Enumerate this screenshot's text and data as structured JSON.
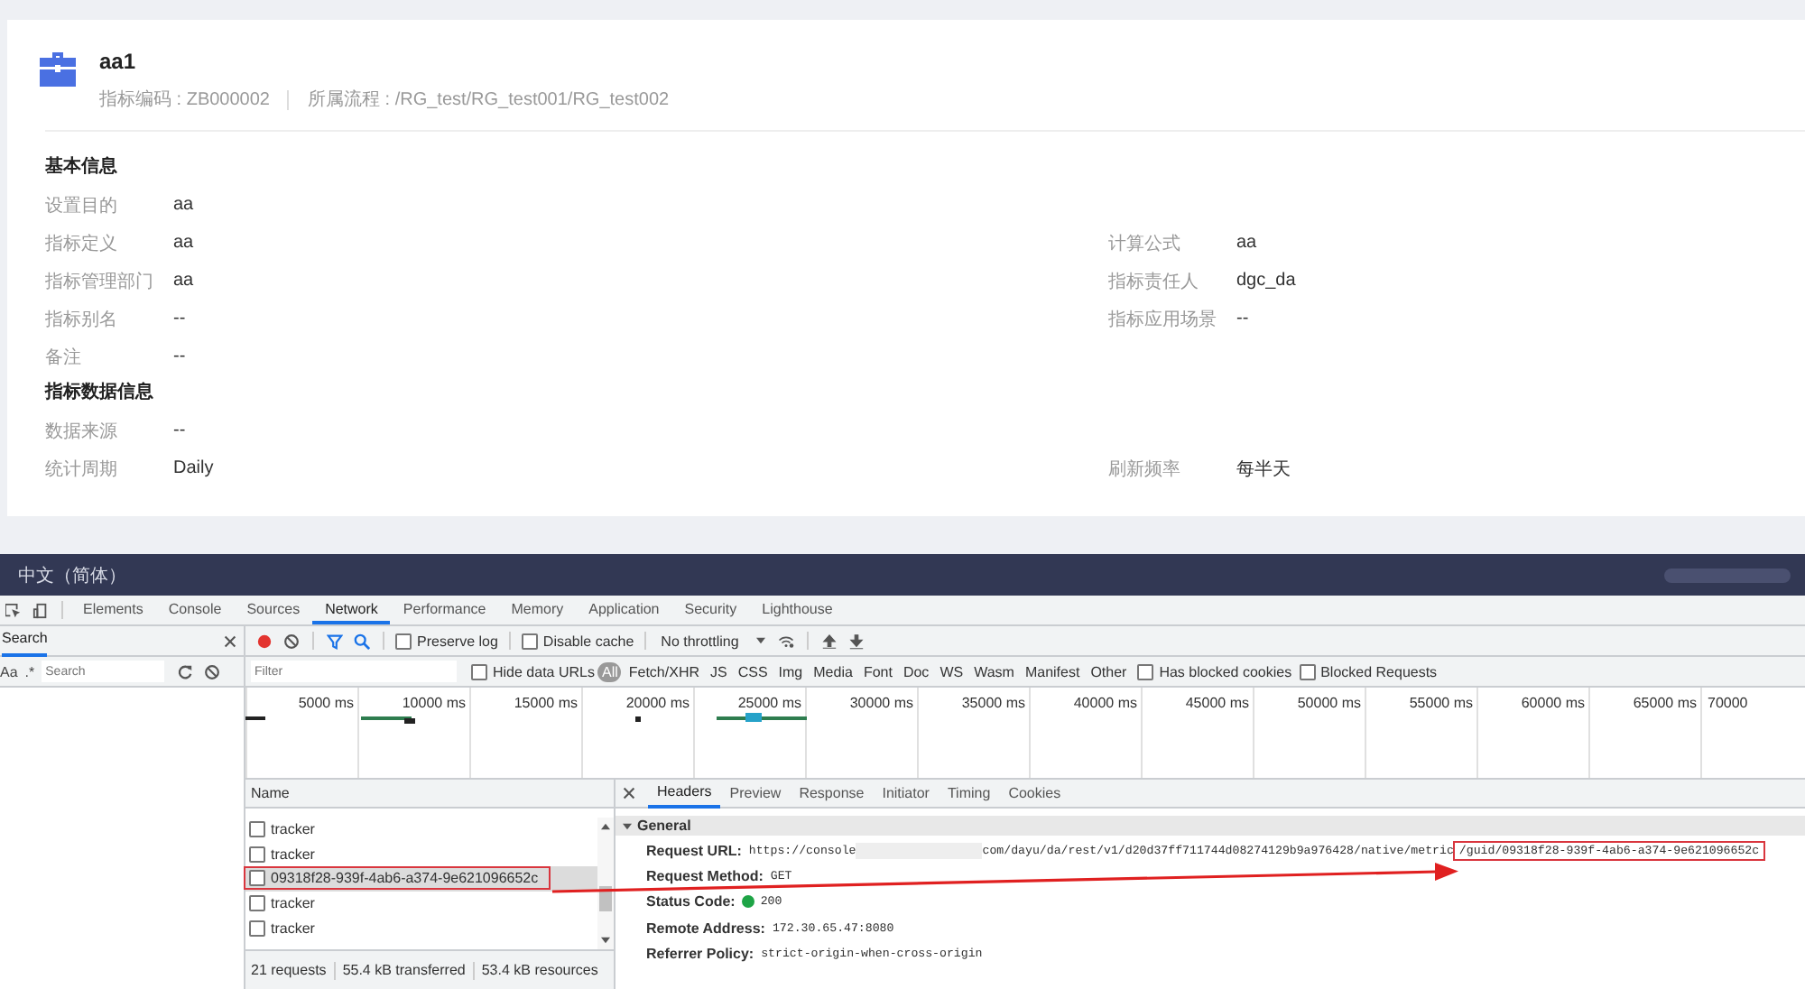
{
  "page": {
    "title": "aa1",
    "meta": [
      "指标编码 : ZB000002",
      "所属流程 : /RG_test/RG_test001/RG_test002"
    ],
    "sections": [
      {
        "title": "基本信息",
        "rows": [
          {
            "left": {
              "label": "设置目的",
              "value": "aa"
            }
          },
          {
            "left": {
              "label": "指标定义",
              "value": "aa"
            },
            "right": {
              "label": "计算公式",
              "value": "aa"
            }
          },
          {
            "left": {
              "label": "指标管理部门",
              "value": "aa"
            },
            "right": {
              "label": "指标责任人",
              "value": "dgc_da"
            }
          },
          {
            "left": {
              "label": "指标别名",
              "value": "--"
            },
            "right": {
              "label": "指标应用场景",
              "value": "--"
            }
          },
          {
            "left": {
              "label": "备注",
              "value": "--"
            }
          }
        ]
      },
      {
        "title": "指标数据信息",
        "rows": [
          {
            "left": {
              "label": "数据来源",
              "value": "--"
            }
          },
          {
            "left": {
              "label": "统计周期",
              "value": "Daily"
            },
            "right": {
              "label": "刷新频率",
              "value": "每半天"
            }
          }
        ]
      }
    ]
  },
  "language_bar": {
    "label": "中文（简体）"
  },
  "devtools": {
    "tabs": [
      {
        "label": "Elements",
        "selected": false
      },
      {
        "label": "Console",
        "selected": false
      },
      {
        "label": "Sources",
        "selected": false
      },
      {
        "label": "Network",
        "selected": true
      },
      {
        "label": "Performance",
        "selected": false
      },
      {
        "label": "Memory",
        "selected": false
      },
      {
        "label": "Application",
        "selected": false
      },
      {
        "label": "Security",
        "selected": false
      },
      {
        "label": "Lighthouse",
        "selected": false
      }
    ],
    "search_panel": {
      "title": "Search",
      "case_toggle": "Aa",
      "regex_toggle": ".*",
      "placeholder": "Search"
    },
    "toolbar": {
      "recording": true,
      "checks": [
        {
          "label": "Preserve log",
          "checked": false
        },
        {
          "label": "Disable cache",
          "checked": false
        }
      ],
      "throttling": "No throttling"
    },
    "filter": {
      "placeholder": "Filter",
      "hide_data": {
        "label": "Hide data URLs",
        "checked": false
      },
      "types": [
        {
          "label": "All",
          "selected": true
        },
        {
          "label": "Fetch/XHR",
          "selected": false
        },
        {
          "label": "JS",
          "selected": false
        },
        {
          "label": "CSS",
          "selected": false
        },
        {
          "label": "Img",
          "selected": false
        },
        {
          "label": "Media",
          "selected": false
        },
        {
          "label": "Font",
          "selected": false
        },
        {
          "label": "Doc",
          "selected": false
        },
        {
          "label": "WS",
          "selected": false
        },
        {
          "label": "Wasm",
          "selected": false
        },
        {
          "label": "Manifest",
          "selected": false
        },
        {
          "label": "Other",
          "selected": false
        }
      ],
      "checks": [
        {
          "label": "Has blocked cookies",
          "checked": false
        },
        {
          "label": "Blocked Requests",
          "checked": false
        }
      ]
    },
    "timeline": {
      "ticks": [
        "5000 ms",
        "10000 ms",
        "15000 ms",
        "20000 ms",
        "25000 ms",
        "30000 ms",
        "35000 ms",
        "40000 ms",
        "45000 ms",
        "50000 ms",
        "55000 ms",
        "60000 ms",
        "65000 ms",
        "70000"
      ]
    },
    "requests": {
      "header": "Name",
      "rows": [
        {
          "name": "tracker",
          "selected": false,
          "highlighted": false
        },
        {
          "name": "tracker",
          "selected": false,
          "highlighted": false
        },
        {
          "name": "09318f28-939f-4ab6-a374-9e621096652c",
          "selected": true,
          "highlighted": true
        },
        {
          "name": "tracker",
          "selected": false,
          "highlighted": false
        },
        {
          "name": "tracker",
          "selected": false,
          "highlighted": false
        }
      ],
      "summary": [
        "21 requests",
        "55.4 kB transferred",
        "53.4 kB resources"
      ]
    },
    "details": {
      "tabs": [
        {
          "label": "Headers",
          "selected": true
        },
        {
          "label": "Preview",
          "selected": false
        },
        {
          "label": "Response",
          "selected": false
        },
        {
          "label": "Initiator",
          "selected": false
        },
        {
          "label": "Timing",
          "selected": false
        },
        {
          "label": "Cookies",
          "selected": false
        }
      ],
      "section": {
        "title": "General",
        "expanded": true
      },
      "url": {
        "label": "Request URL:",
        "start": "https://console",
        "rest": "com/dayu/da/rest/v1/d20d37ff711744d08274129b9a976428/native/metric",
        "highlight": "/guid/09318f28-939f-4ab6-a374-9e621096652c"
      },
      "fields": [
        {
          "label": "Request Method:",
          "value": "GET",
          "kind": "text"
        },
        {
          "label": "Status Code:",
          "value": "200",
          "kind": "status",
          "color": "#1ea446"
        },
        {
          "label": "Remote Address:",
          "value": "172.30.65.47:8080",
          "kind": "text"
        },
        {
          "label": "Referrer Policy:",
          "value": "strict-origin-when-cross-origin",
          "kind": "text"
        }
      ]
    }
  }
}
